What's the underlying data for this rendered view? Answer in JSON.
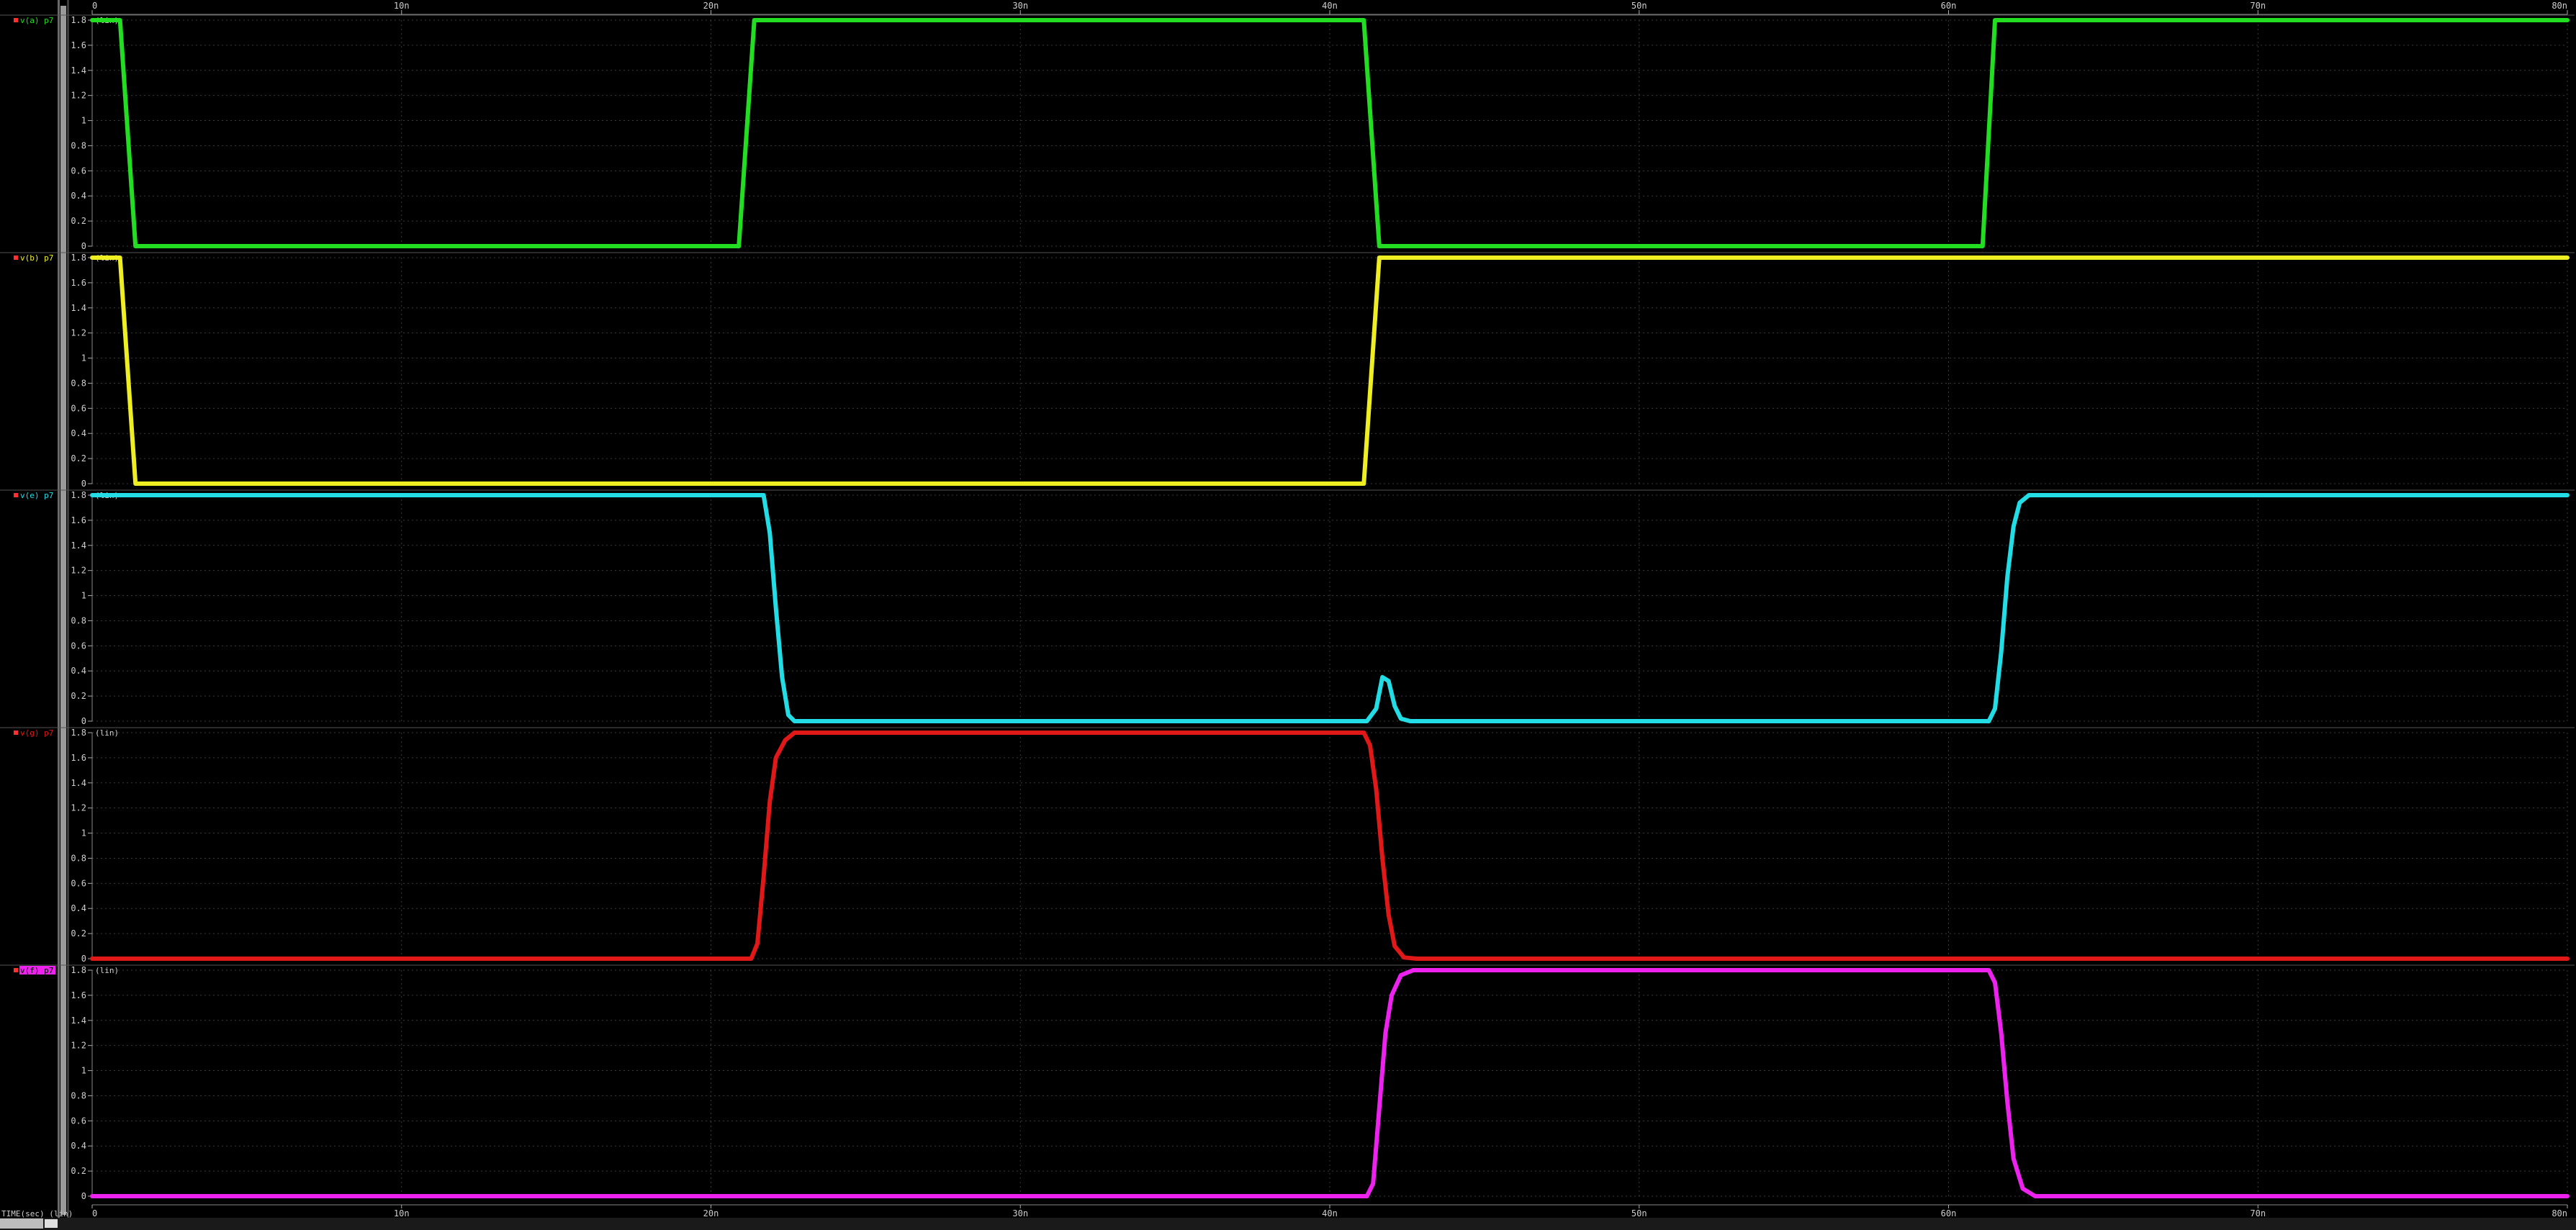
{
  "window": {
    "background": "#000000",
    "grid_color": "#3a3a3a",
    "axis_text_color": "#cfcfcf"
  },
  "top_axis": {
    "ticks": [
      {
        "t": 0,
        "label": "0"
      },
      {
        "t": 10,
        "label": "10n"
      },
      {
        "t": 20,
        "label": "20n"
      },
      {
        "t": 30,
        "label": "30n"
      },
      {
        "t": 40,
        "label": "40n"
      },
      {
        "t": 50,
        "label": "50n"
      },
      {
        "t": 60,
        "label": "60n"
      },
      {
        "t": 70,
        "label": "70n"
      },
      {
        "t": 80,
        "label": "80n"
      }
    ]
  },
  "bottom_axis": {
    "label": "TIME(sec) (lin)",
    "ticks": [
      {
        "t": 0,
        "label": "0"
      },
      {
        "t": 10,
        "label": "10n"
      },
      {
        "t": 20,
        "label": "20n"
      },
      {
        "t": 30,
        "label": "30n"
      },
      {
        "t": 40,
        "label": "40n"
      },
      {
        "t": 50,
        "label": "50n"
      },
      {
        "t": 60,
        "label": "60n"
      },
      {
        "t": 70,
        "label": "70n"
      },
      {
        "t": 80,
        "label": "80n"
      }
    ]
  },
  "chart_data": [
    {
      "type": "line",
      "panel_label": "v(a) p7",
      "unit_label": "(lin)",
      "color": "#22dd22",
      "xlim": [
        0,
        80
      ],
      "ylim": [
        0,
        1.8
      ],
      "ytick_labels": [
        "0",
        "0.2",
        "0.4",
        "0.6",
        "0.8",
        "1",
        "1.2",
        "1.4",
        "1.6",
        "1.8"
      ],
      "series": [
        {
          "x": [
            0,
            0.9,
            1.4,
            20.9,
            21.4,
            41.1,
            41.6,
            61.1,
            61.5,
            80
          ],
          "y": [
            1.8,
            1.8,
            0,
            0,
            1.8,
            1.8,
            0,
            0,
            1.8,
            1.8
          ]
        }
      ]
    },
    {
      "type": "line",
      "panel_label": "v(b) p7",
      "unit_label": "(lin)",
      "color": "#eeee22",
      "xlim": [
        0,
        80
      ],
      "ylim": [
        0,
        1.8
      ],
      "ytick_labels": [
        "0",
        "0.2",
        "0.4",
        "0.6",
        "0.8",
        "1",
        "1.2",
        "1.4",
        "1.6",
        "1.8"
      ],
      "series": [
        {
          "x": [
            0,
            0.9,
            1.4,
            41.1,
            41.6,
            80
          ],
          "y": [
            1.8,
            1.8,
            0,
            0,
            1.8,
            1.8
          ]
        }
      ]
    },
    {
      "type": "line",
      "panel_label": "v(e) p7",
      "unit_label": "(lin)",
      "color": "#22dde6",
      "xlim": [
        0,
        80
      ],
      "ylim": [
        0,
        1.8
      ],
      "ytick_labels": [
        "0",
        "0.2",
        "0.4",
        "0.6",
        "0.8",
        "1",
        "1.2",
        "1.4",
        "1.6",
        "1.8"
      ],
      "series": [
        {
          "x": [
            0,
            21.7,
            21.9,
            22.1,
            22.3,
            22.5,
            22.7,
            22.9,
            23.2,
            41.2,
            41.5,
            41.7,
            41.9,
            42.1,
            42.3,
            42.6,
            61.3,
            61.5,
            61.7,
            61.9,
            62.1,
            62.3,
            62.6,
            63.0,
            80
          ],
          "y": [
            1.8,
            1.8,
            1.5,
            0.9,
            0.35,
            0.05,
            0.0,
            0.0,
            0.0,
            0.0,
            0.1,
            0.35,
            0.32,
            0.12,
            0.02,
            0.0,
            0.0,
            0.1,
            0.55,
            1.15,
            1.55,
            1.74,
            1.8,
            1.8,
            1.8
          ]
        }
      ]
    },
    {
      "type": "line",
      "panel_label": "v(g) p7",
      "unit_label": "(lin)",
      "color": "#e01818",
      "xlim": [
        0,
        80
      ],
      "ylim": [
        0,
        1.8
      ],
      "ytick_labels": [
        "0",
        "0.2",
        "0.4",
        "0.6",
        "0.8",
        "1",
        "1.2",
        "1.4",
        "1.6",
        "1.8"
      ],
      "series": [
        {
          "x": [
            0,
            21.3,
            21.5,
            21.7,
            21.9,
            22.1,
            22.4,
            22.7,
            23.0,
            41.1,
            41.3,
            41.5,
            41.7,
            41.9,
            42.1,
            42.4,
            42.8,
            80
          ],
          "y": [
            0,
            0,
            0.12,
            0.65,
            1.25,
            1.6,
            1.74,
            1.8,
            1.8,
            1.8,
            1.7,
            1.35,
            0.8,
            0.35,
            0.1,
            0.01,
            0,
            0
          ]
        }
      ]
    },
    {
      "type": "line",
      "panel_label": "v(f) p7",
      "unit_label": "(lin)",
      "color": "#ee22ee",
      "xlim": [
        0,
        80
      ],
      "ylim": [
        0,
        1.8
      ],
      "ytick_labels": [
        "0",
        "0.2",
        "0.4",
        "0.6",
        "0.8",
        "1",
        "1.2",
        "1.4",
        "1.6",
        "1.8"
      ],
      "series": [
        {
          "x": [
            0,
            41.2,
            41.4,
            41.6,
            41.8,
            42.0,
            42.3,
            42.7,
            61.3,
            61.5,
            61.7,
            61.9,
            62.1,
            62.4,
            62.8,
            80
          ],
          "y": [
            0,
            0,
            0.1,
            0.7,
            1.3,
            1.6,
            1.76,
            1.8,
            1.8,
            1.7,
            1.3,
            0.75,
            0.3,
            0.06,
            0,
            0
          ]
        }
      ]
    }
  ]
}
